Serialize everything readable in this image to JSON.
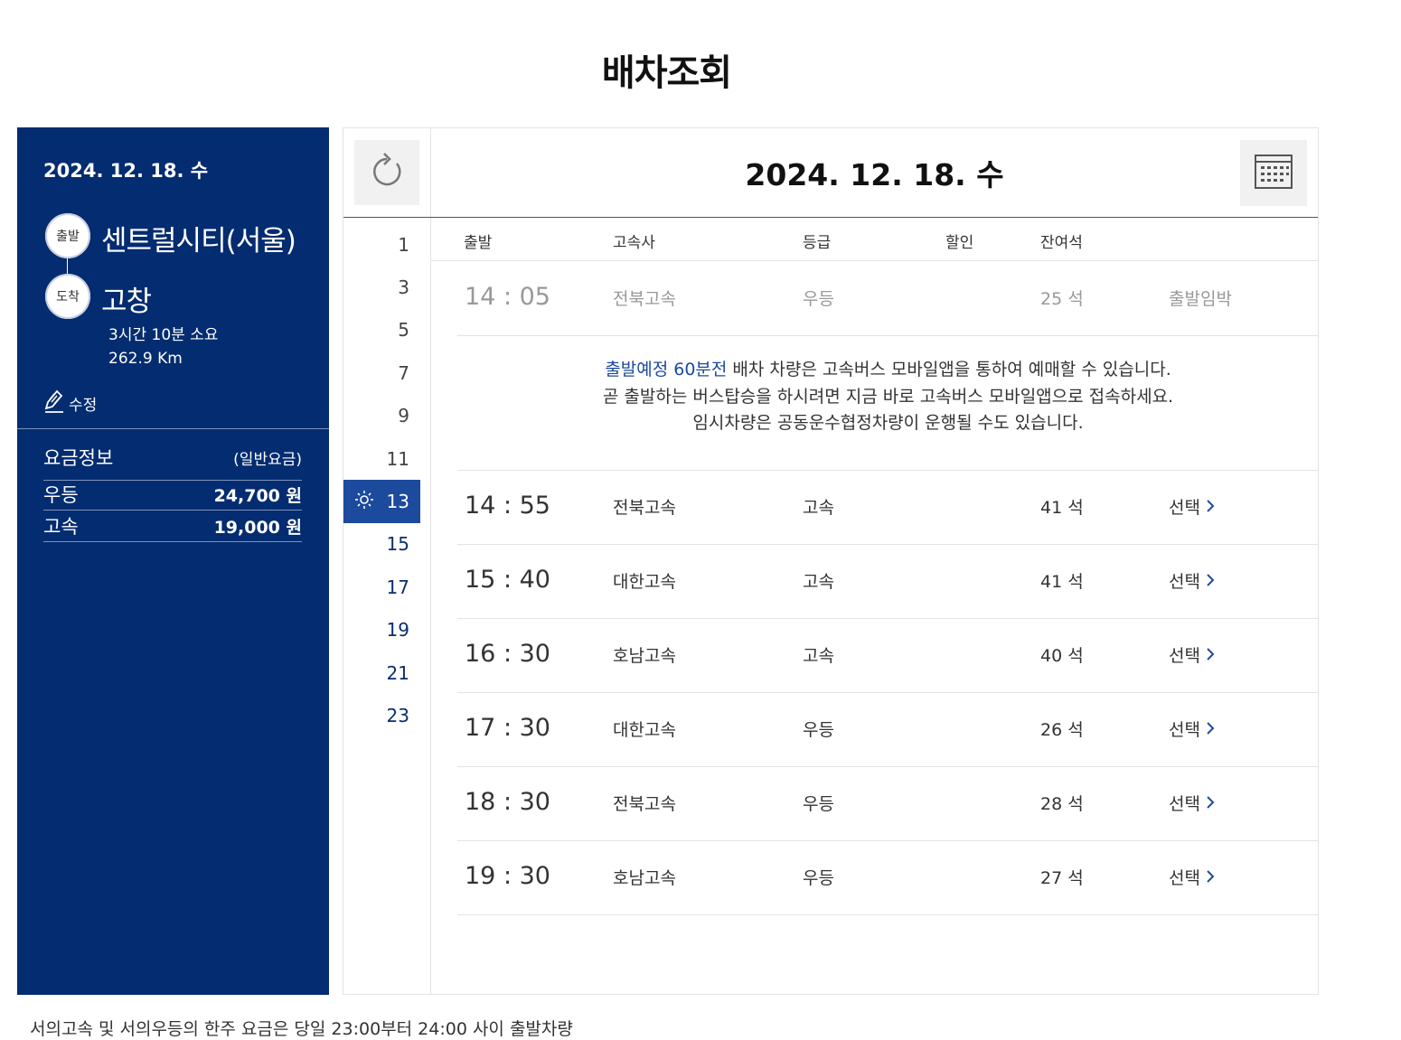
{
  "page_title": "배차조회",
  "route": {
    "date": "2024. 12. 18. 수",
    "departure_label": "출발",
    "departure": "센트럴시티(서울)",
    "arrival_label": "도착",
    "arrival": "고창",
    "duration": "3시간 10분 소요",
    "distance": "262.9 Km",
    "edit_label": "수정"
  },
  "fare": {
    "title": "요금정보",
    "subtitle": "(일반요금)",
    "rows": [
      {
        "grade": "우등",
        "price": "24,700 원"
      },
      {
        "grade": "고속",
        "price": "19,000 원"
      }
    ]
  },
  "main": {
    "date": "2024. 12. 18. 수",
    "hours": [
      "1",
      "3",
      "5",
      "7",
      "9",
      "11",
      "13",
      "15",
      "17",
      "19",
      "21",
      "23"
    ],
    "active_hour": "13",
    "columns": [
      "출발",
      "고속사",
      "등급",
      "할인",
      "잔여석"
    ],
    "past_row": {
      "time": "14 : 05",
      "company": "전북고속",
      "grade": "우등",
      "seats": "25 석",
      "status": "출발임박"
    },
    "notice": {
      "highlight": "출발예정 60분전",
      "line1": " 배차 차량은 고속버스 모바일앱을 통하여 예매할 수 있습니다.",
      "line2": "곧 출발하는 버스탑승을 하시려면 지금 바로 고속버스 모바일앱으로 접속하세요.",
      "line3": "임시차량은 공동운수협정차량이 운행될 수도 있습니다."
    },
    "rows": [
      {
        "time": "14 : 55",
        "company": "전북고속",
        "grade": "고속",
        "seats": "41 석",
        "action": "선택"
      },
      {
        "time": "15 : 40",
        "company": "대한고속",
        "grade": "고속",
        "seats": "41 석",
        "action": "선택"
      },
      {
        "time": "16 : 30",
        "company": "호남고속",
        "grade": "고속",
        "seats": "40 석",
        "action": "선택"
      },
      {
        "time": "17 : 30",
        "company": "대한고속",
        "grade": "우등",
        "seats": "26 석",
        "action": "선택"
      },
      {
        "time": "18 : 30",
        "company": "전북고속",
        "grade": "우등",
        "seats": "28 석",
        "action": "선택"
      },
      {
        "time": "19 : 30",
        "company": "호남고속",
        "grade": "우등",
        "seats": "27 석",
        "action": "선택"
      }
    ]
  },
  "footer": "서의고속 및 서의우등의 한주 요금은 당일 23:00부터 24:00 사이 출발차량",
  "colors": {
    "panel": "#042c70",
    "active": "#1c4a9c",
    "link": "#214a9a"
  },
  "icons": {
    "refresh": "refresh-icon",
    "calendar": "calendar-icon",
    "edit": "pencil-icon",
    "sun": "sun-icon",
    "chevron": "chevron-right-icon"
  }
}
